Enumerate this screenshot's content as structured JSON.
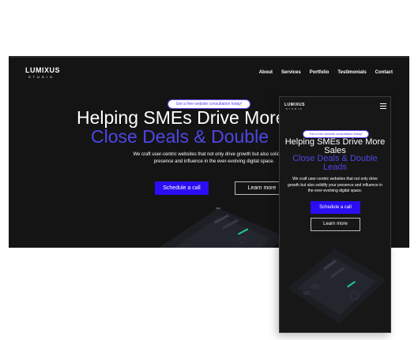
{
  "desktop": {
    "brand": {
      "name": "LUMIXUS",
      "tagline": "STUDIO"
    },
    "nav": [
      {
        "label": "About"
      },
      {
        "label": "Services"
      },
      {
        "label": "Portfolio"
      },
      {
        "label": "Testimonials"
      },
      {
        "label": "Contact"
      }
    ],
    "hero": {
      "badge": "Get a free website consultation today!",
      "title_line1": "Helping SMEs Drive More",
      "title_line2": "Close Deals & Double",
      "description": "We craft user-centric websites that not only drive growth but also solidify your presence and influence in the ever-evolving digital space.",
      "primary_cta": "Schedule a call",
      "secondary_cta": "Learn more"
    }
  },
  "mobile": {
    "brand": {
      "name": "LUMIXUS",
      "tagline": "STUDIO"
    },
    "hero": {
      "badge": "Get a free website consultation today!",
      "title_line1": "Helping SMEs Drive More Sales",
      "title_line2": "Close Deals & Double Leads",
      "description": "We craft user-centric websites that not only drive growth but also solidify your presence and influence in the ever-evolving digital space.",
      "primary_cta": "Schedule a call",
      "secondary_cta": "Learn more"
    }
  },
  "colors": {
    "background": "#141414",
    "accent_text": "#4f46e5",
    "cta": "#2a0df2",
    "badge_text": "#5b3bf0"
  },
  "icons": {
    "mobile_menu": "hamburger-icon"
  }
}
